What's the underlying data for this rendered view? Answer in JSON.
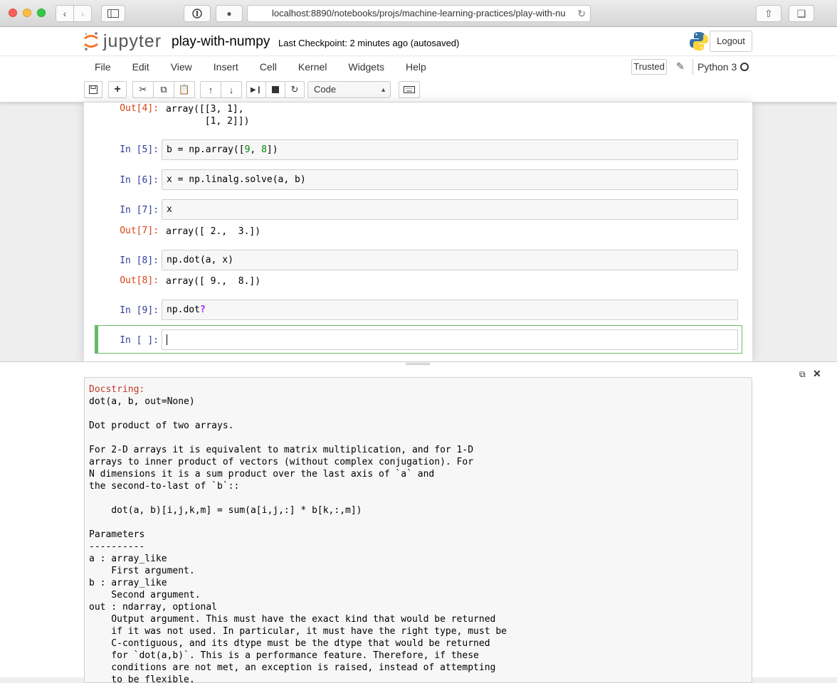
{
  "browser": {
    "url": "localhost:8890/notebooks/projs/machine-learning-practices/play-with-nu"
  },
  "header": {
    "logo_text": "jupyter",
    "notebook_name": "play-with-numpy",
    "checkpoint": "Last Checkpoint: 2 minutes ago (autosaved)",
    "logout_label": "Logout",
    "trusted_label": "Trusted",
    "kernel_name": "Python 3"
  },
  "menu": {
    "items": [
      "File",
      "Edit",
      "View",
      "Insert",
      "Cell",
      "Kernel",
      "Widgets",
      "Help"
    ]
  },
  "toolbar": {
    "cell_type": "Code"
  },
  "cells": [
    {
      "out_prompt": "Out[4]:",
      "output": "array([[3, 1],\n       [1, 2]])"
    },
    {
      "in_prompt": "In [5]:",
      "code_prefix": "b = np.array([",
      "n1": "9",
      "sep": ", ",
      "n2": "8",
      "code_suffix": "])"
    },
    {
      "in_prompt": "In [6]:",
      "code": "x = np.linalg.solve(a, b)"
    },
    {
      "in_prompt": "In [7]:",
      "code": "x",
      "out_prompt": "Out[7]:",
      "output": "array([ 2.,  3.])"
    },
    {
      "in_prompt": "In [8]:",
      "code": "np.dot(a, x)",
      "out_prompt": "Out[8]:",
      "output": "array([ 9.,  8.])"
    },
    {
      "in_prompt": "In [9]:",
      "code": "np.dot",
      "op": "?"
    },
    {
      "in_prompt": "In [ ]:",
      "code": ""
    }
  ],
  "pager": {
    "header": "Docstring:",
    "body": "dot(a, b, out=None)\n\nDot product of two arrays.\n\nFor 2-D arrays it is equivalent to matrix multiplication, and for 1-D\narrays to inner product of vectors (without complex conjugation). For\nN dimensions it is a sum product over the last axis of `a` and\nthe second-to-last of `b`::\n\n    dot(a, b)[i,j,k,m] = sum(a[i,j,:] * b[k,:,m])\n\nParameters\n----------\na : array_like\n    First argument.\nb : array_like\n    Second argument.\nout : ndarray, optional\n    Output argument. This must have the exact kind that would be returned\n    if it was not used. In particular, it must have the right type, must be\n    C-contiguous, and its dtype must be the dtype that would be returned\n    for `dot(a,b)`. This is a performance feature. Therefore, if these\n    conditions are not met, an exception is raised, instead of attempting\n    to be flexible."
  },
  "colors": {
    "in_prompt": "#303f9f",
    "out_prompt": "#d84315",
    "selected_cell": "#66bb6a",
    "docstring_header": "#c0392b"
  }
}
